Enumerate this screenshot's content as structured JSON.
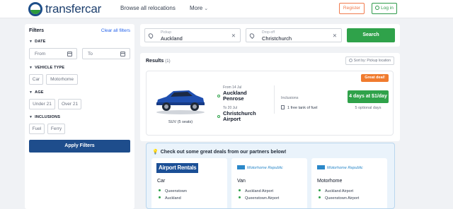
{
  "header": {
    "logo_text": "transfercar",
    "nav": {
      "browse": "Browse all relocations",
      "more": "More"
    },
    "register_label": "Register",
    "login_label": "Log in",
    "colors": {
      "brand_blue": "#1d4e89",
      "brand_green": "#2c9a3c",
      "register": "#f07b4e",
      "login": "#2e9a4a"
    }
  },
  "filters": {
    "title": "Filters",
    "clear_all": "Clear all filters",
    "sections": {
      "date": "DATE",
      "vehicle_type": "VEHICLE TYPE",
      "age": "AGE",
      "inclusions": "INCLUSIONS"
    },
    "date_from_placeholder": "From",
    "date_to_placeholder": "To",
    "vehicle_types": [
      "Car",
      "Motorhome"
    ],
    "ages": [
      "Under 21",
      "Over 21"
    ],
    "inclusions": [
      "Fuel",
      "Ferry"
    ],
    "apply_label": "Apply Filters"
  },
  "search": {
    "pickup_label": "Pickup",
    "pickup_value": "Auckland",
    "dropoff_label": "Drop-off",
    "dropoff_value": "Christchurch",
    "button_label": "Search"
  },
  "results": {
    "title": "Results",
    "count": "(1)",
    "sort_label": "Sort by: Pickup location",
    "items": [
      {
        "badge": "Great deal!",
        "vehicle_caption": "SUV (5 seats)",
        "from_date": "From 14 Jul",
        "from_place": [
          "Auckland",
          "Penrose"
        ],
        "to_date": "To 20 Jul",
        "to_place": [
          "Christchurch",
          "Airport"
        ],
        "inclusions_heading": "Inclusions",
        "inclusion_item": "1 free tank of fuel",
        "price_label": "4 days at $1/day",
        "optional_days": "5 optional days"
      }
    ]
  },
  "partners": {
    "heading": "Check out some great deals from our partners below!",
    "cards": [
      {
        "logo": "Airport Rentals",
        "type": "Car",
        "locations": [
          "Queenstown",
          "Auckland"
        ]
      },
      {
        "logo": "Motorhome Republic",
        "type": "Van",
        "locations": [
          "Auckland Airport",
          "Queenstown Airport"
        ]
      },
      {
        "logo": "Motorhome Republic",
        "type": "Motorhome",
        "locations": [
          "Auckland Airport",
          "Queenstown Airport"
        ]
      }
    ]
  }
}
